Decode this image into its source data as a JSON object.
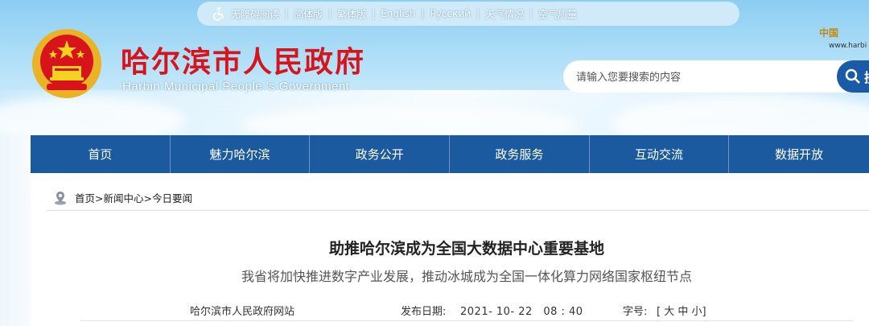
{
  "topbar": {
    "links": [
      "无障碍阅读",
      "简体版",
      "繁体版",
      "English",
      "Русский",
      "天气情况",
      "空气质量"
    ]
  },
  "site": {
    "title": "哈尔滨市人民政府",
    "subtitle": "Harbin Municipal People 's Government",
    "china_logo_text": "中国",
    "china_url": "www.harbi"
  },
  "search": {
    "placeholder": "请输入您要搜索的内容",
    "button_label": "搜"
  },
  "nav": {
    "items": [
      "首页",
      "魅力哈尔滨",
      "政务公开",
      "政务服务",
      "互动交流",
      "数据开放"
    ]
  },
  "breadcrumb": {
    "text": "首页>新闻中心>今日要闻"
  },
  "article": {
    "title": "助推哈尔滨成为全国大数据中心重要基地",
    "subtitle": "我省将加快推进数字产业发展，推动冰城成为全国一体化算力网络国家枢纽节点",
    "source": "哈尔滨市人民政府网站",
    "date_label": "发布日期:",
    "date": "2021- 10- 22　08 : 40",
    "font_label": "字号:",
    "font_options": "[ 大 中 小]"
  },
  "colors": {
    "nav_bg": "#1c5aa0",
    "title_red": "#d7131b",
    "search_button": "#1b5aa6"
  }
}
